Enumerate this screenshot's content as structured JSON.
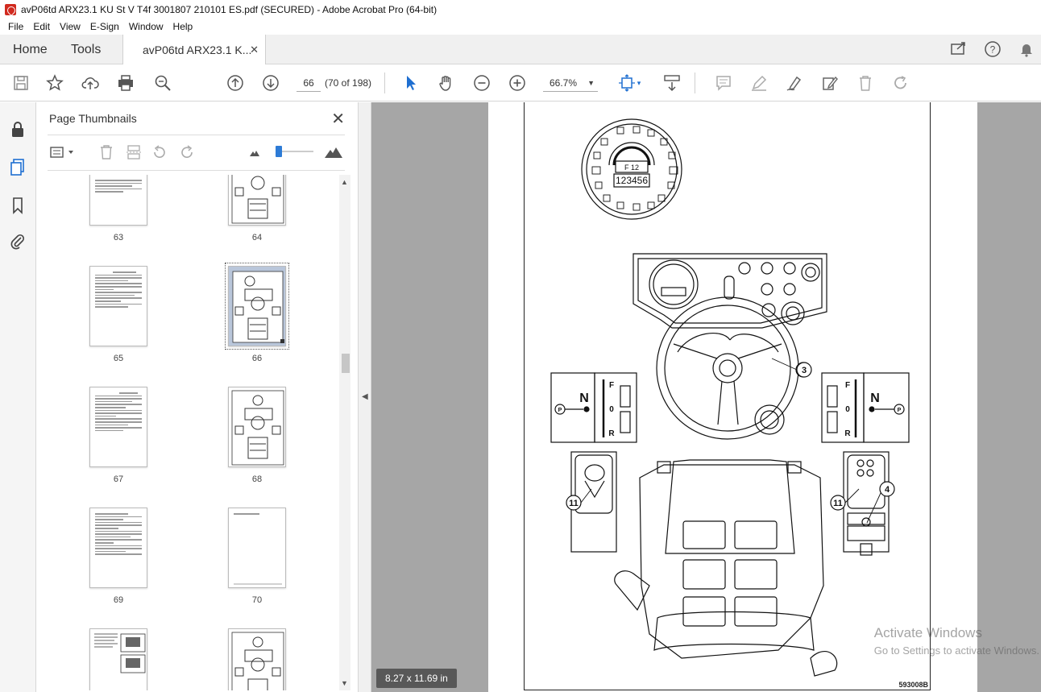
{
  "window": {
    "title": "avP06td ARX23.1 KU St V T4f 3001807 210101 ES.pdf (SECURED) - Adobe Acrobat Pro (64-bit)"
  },
  "menu": [
    "File",
    "Edit",
    "View",
    "E-Sign",
    "Window",
    "Help"
  ],
  "tabs": {
    "home": "Home",
    "tools": "Tools",
    "doc": "avP06td ARX23.1 K...",
    "close": "✕"
  },
  "toolbar": {
    "page_number": "66",
    "page_count": "(70 of 198)",
    "zoom": "66.7%"
  },
  "thumbnails": {
    "title": "Page Thumbnails",
    "close": "✕",
    "pages": [
      "63",
      "64",
      "65",
      "66",
      "67",
      "68",
      "69",
      "70",
      "",
      ""
    ],
    "selected": "66"
  },
  "document": {
    "page_size": "8.27 x 11.69 in",
    "figure_code": "593008B",
    "callouts": [
      "3",
      "4",
      "11",
      "11"
    ],
    "gear_labels": {
      "neutral": "N",
      "forward": "F",
      "zero": "0",
      "reverse": "R",
      "park": "P"
    },
    "dash_display": {
      "gear": "F 12",
      "hours": "123456"
    }
  },
  "watermark": {
    "line1": "Activate Windows",
    "line2": "Go to Settings to activate Windows."
  }
}
